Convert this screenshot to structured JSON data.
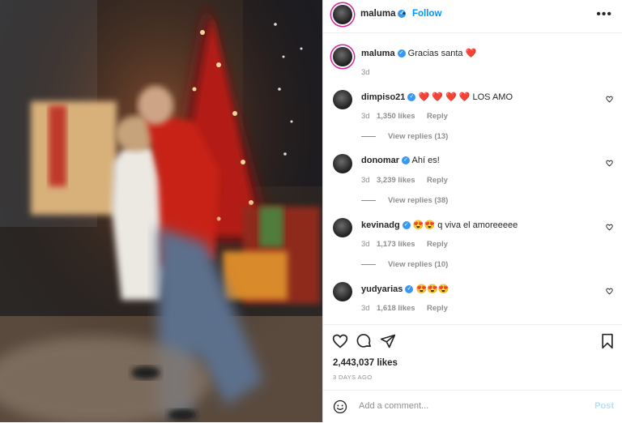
{
  "header": {
    "username": "maluma",
    "separator": "•",
    "follow_label": "Follow",
    "more_icon": "more-horizontal-icon",
    "verified_glyph": "✓"
  },
  "caption": {
    "username": "maluma",
    "text": "Gracias santa",
    "emoji": "❤️",
    "time": "3d"
  },
  "comments": [
    {
      "username": "dimpiso21",
      "text": "❤️ ❤️ ❤️ ❤️ LOS AMO",
      "time": "3d",
      "likes": "1,350 likes",
      "reply": "Reply",
      "view_replies": "View replies (13)"
    },
    {
      "username": "donomar",
      "text": "Ahí es!",
      "time": "3d",
      "likes": "3,239 likes",
      "reply": "Reply",
      "view_replies": "View replies (38)"
    },
    {
      "username": "kevinadg",
      "text": "😍😍 q viva el amoreeeee",
      "time": "3d",
      "likes": "1,173 likes",
      "reply": "Reply",
      "view_replies": "View replies (10)"
    },
    {
      "username": "yudyarias",
      "text": "😍😍😍",
      "time": "3d",
      "likes": "1,618 likes",
      "reply": "Reply"
    }
  ],
  "footer": {
    "likes": "2,443,037 likes",
    "age": "3 DAYS AGO",
    "comment_placeholder": "Add a comment...",
    "post_label": "Post"
  },
  "colors": {
    "accent": "#0095f6",
    "verified": "#3897f0",
    "muted": "#8e8e8e",
    "post_disabled": "#b2dffc"
  }
}
